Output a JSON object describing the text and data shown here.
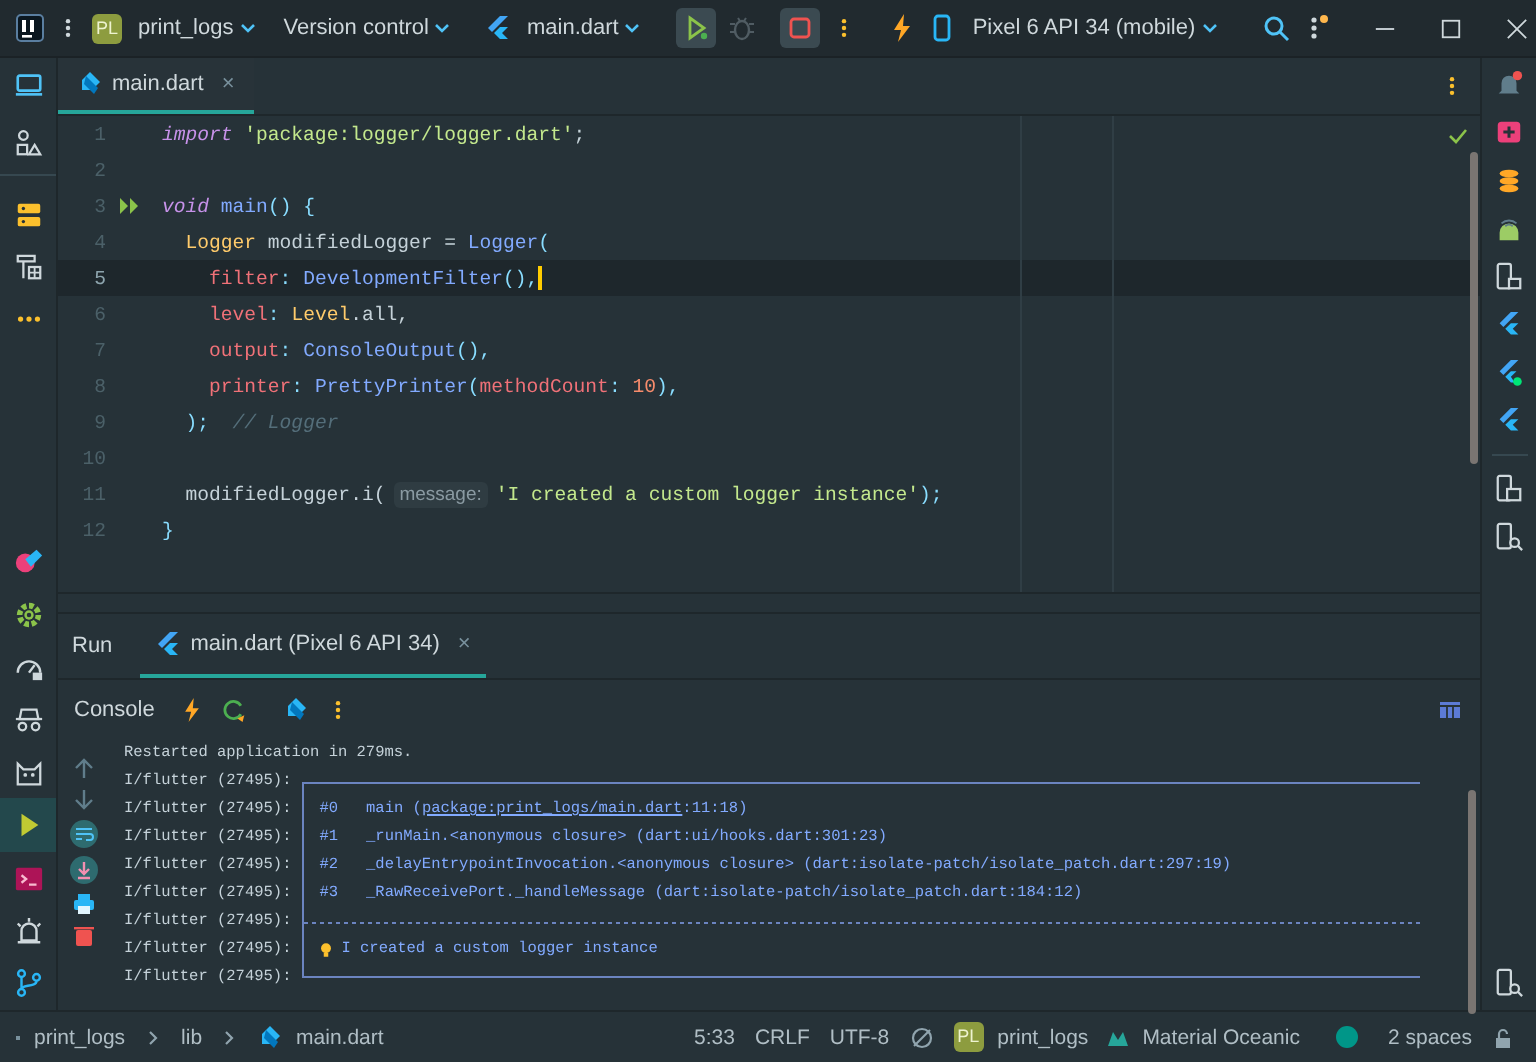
{
  "title_bar": {
    "project_badge": "PL",
    "project": "print_logs",
    "vcs": "Version control",
    "run_config": "main.dart",
    "device": "Pixel 6 API 34 (mobile)",
    "debug_disabled": true
  },
  "left_toolbar": {
    "top": [
      {
        "selected": false
      },
      {
        "selected": false
      },
      {
        "selected": false
      },
      {
        "selected": false
      },
      {
        "selected": false
      }
    ],
    "bottom": [
      {
        "selected": false
      },
      {
        "selected": false
      },
      {
        "selected": false
      },
      {
        "selected": false
      },
      {
        "selected": false
      },
      {
        "selected": true
      },
      {
        "selected": false
      },
      {
        "selected": false
      },
      {
        "selected": false
      }
    ]
  },
  "editor": {
    "tabs": [
      {
        "label": "main.dart",
        "close": "×",
        "selected": true
      }
    ],
    "lines": [
      {
        "number": "1",
        "run_marker": false,
        "current": false,
        "tokens": [
          {
            "kind": "keyword",
            "text": "import"
          },
          {
            "kind": "string",
            "text": " 'package:logger/logger.dart'"
          },
          {
            "kind": "plain",
            "text": ";"
          }
        ]
      },
      {
        "number": "2",
        "run_marker": false,
        "current": false
      },
      {
        "number": "3",
        "run_marker": true,
        "current": false,
        "tokens": [
          {
            "kind": "keyword",
            "text": "void"
          },
          {
            "kind": "function",
            "text": " main"
          },
          {
            "kind": "punct",
            "text": "() {"
          }
        ]
      },
      {
        "number": "4",
        "run_marker": false,
        "current": false,
        "tokens": [
          {
            "kind": "type",
            "text": "  Logger"
          },
          {
            "kind": "plain",
            "text": " modifiedLogger = "
          },
          {
            "kind": "class",
            "text": "Logger"
          },
          {
            "kind": "punct",
            "text": "("
          }
        ]
      },
      {
        "number": "5",
        "run_marker": false,
        "current": true,
        "tokens": [
          {
            "kind": "param",
            "text": "    filter"
          },
          {
            "kind": "punct",
            "text": ": "
          },
          {
            "kind": "class",
            "text": "DevelopmentFilter"
          },
          {
            "kind": "punct",
            "text": "(),"
          }
        ]
      },
      {
        "number": "6",
        "run_marker": false,
        "current": false,
        "tokens": [
          {
            "kind": "param",
            "text": "    level"
          },
          {
            "kind": "punct",
            "text": ": "
          },
          {
            "kind": "type",
            "text": "Level"
          },
          {
            "kind": "plain",
            "text": ".all,"
          }
        ]
      },
      {
        "number": "7",
        "run_marker": false,
        "current": false,
        "tokens": [
          {
            "kind": "param",
            "text": "    output"
          },
          {
            "kind": "punct",
            "text": ": "
          },
          {
            "kind": "class",
            "text": "ConsoleOutput"
          },
          {
            "kind": "punct",
            "text": "(),"
          }
        ]
      },
      {
        "number": "8",
        "run_marker": false,
        "current": false,
        "tokens": [
          {
            "kind": "param",
            "text": "    printer"
          },
          {
            "kind": "punct",
            "text": ": "
          },
          {
            "kind": "class",
            "text": "PrettyPrinter"
          },
          {
            "kind": "punct",
            "text": "("
          },
          {
            "kind": "param",
            "text": "methodCount"
          },
          {
            "kind": "punct",
            "text": ": "
          },
          {
            "kind": "number",
            "text": "10"
          },
          {
            "kind": "punct",
            "text": "),"
          }
        ]
      },
      {
        "number": "9",
        "run_marker": false,
        "current": false,
        "tokens": [
          {
            "kind": "punct",
            "text": "  );"
          },
          {
            "kind": "comment",
            "text": "  // Logger"
          }
        ]
      },
      {
        "number": "10",
        "run_marker": false,
        "current": false
      },
      {
        "number": "11",
        "run_marker": false,
        "current": false,
        "tokens": [
          {
            "kind": "plain",
            "text": "  modifiedLogger.i("
          },
          {
            "kind": "hint",
            "text": "message:"
          },
          {
            "kind": "string",
            "text": "'I created a custom logger instance'"
          },
          {
            "kind": "punct",
            "text": ");"
          }
        ]
      },
      {
        "number": "12",
        "run_marker": false,
        "current": false,
        "tokens": [
          {
            "kind": "punct",
            "text": "}"
          }
        ]
      }
    ]
  },
  "run_panel": {
    "label": "Run",
    "tabs": [
      {
        "label": "main.dart (Pixel 6 API 34)",
        "close": "×",
        "selected": true
      }
    ],
    "console_label": "Console",
    "lines": [
      {
        "kind": "plain",
        "text": "Restarted application in 279ms."
      },
      {
        "kind": "top",
        "prefix": "I/flutter (27495):"
      },
      {
        "kind": "frame",
        "prefix": "I/flutter (27495):",
        "index": "#0",
        "text": "main (",
        "link": "package:print_logs/main.dart",
        "after": ":11:18)"
      },
      {
        "kind": "frame",
        "prefix": "I/flutter (27495):",
        "index": "#1",
        "text": "_runMain.<anonymous closure> (dart:ui/hooks.dart:301:23)"
      },
      {
        "kind": "frame",
        "prefix": "I/flutter (27495):",
        "index": "#2",
        "text": "_delayEntrypointInvocation.<anonymous closure> (dart:isolate-patch/isolate_patch.dart:297:19)"
      },
      {
        "kind": "frame",
        "prefix": "I/flutter (27495):",
        "index": "#3",
        "text": "_RawReceivePort._handleMessage (dart:isolate-patch/isolate_patch.dart:184:12)"
      },
      {
        "kind": "divider",
        "prefix": "I/flutter (27495):"
      },
      {
        "kind": "message",
        "prefix": "I/flutter (27495):",
        "text": "I created a custom logger instance"
      },
      {
        "kind": "bottom",
        "prefix": "I/flutter (27495):"
      }
    ]
  },
  "status_bar": {
    "breadcrumbs": [
      "print_logs",
      "lib",
      "main.dart"
    ],
    "position": "5:33",
    "line_separator": "CRLF",
    "encoding": "UTF-8",
    "project_badge": "PL",
    "project": "print_logs",
    "theme": "Material Oceanic",
    "indent": "2 spaces"
  }
}
